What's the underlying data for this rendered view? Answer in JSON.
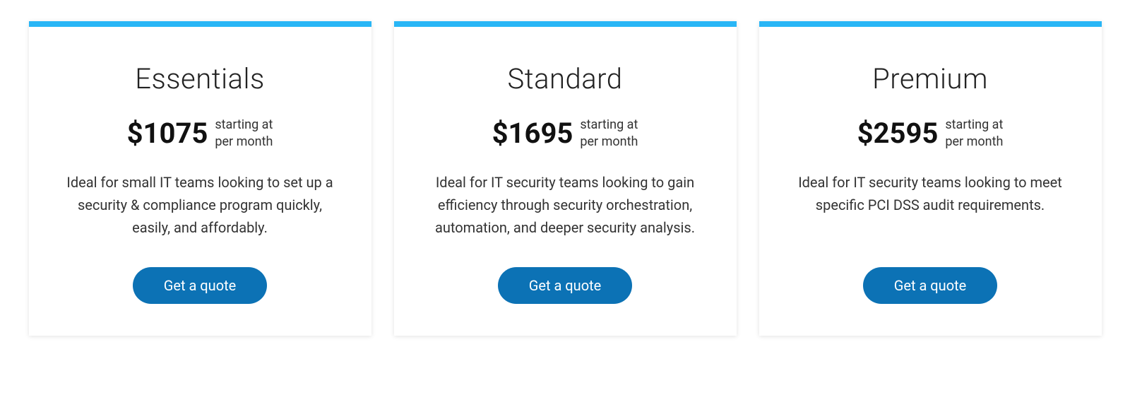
{
  "plans": [
    {
      "title": "Essentials",
      "price": "$1075",
      "starting": "starting at",
      "period": "per month",
      "description": "Ideal for small IT teams looking to set up a security & compliance program quickly, easily, and affordably.",
      "button": "Get a quote"
    },
    {
      "title": "Standard",
      "price": "$1695",
      "starting": "starting at",
      "period": "per month",
      "description": "Ideal for IT security teams looking to gain efficiency through security orchestration, automation, and deeper security analysis.",
      "button": "Get a quote"
    },
    {
      "title": "Premium",
      "price": "$2595",
      "starting": "starting at",
      "period": "per month",
      "description": "Ideal for IT security teams looking to meet specific PCI DSS audit requirements.",
      "button": "Get a quote"
    }
  ]
}
